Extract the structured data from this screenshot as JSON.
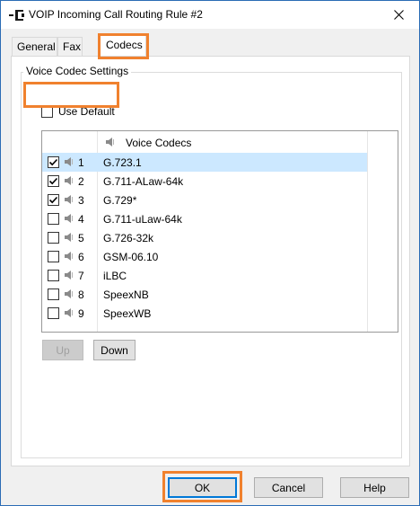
{
  "window": {
    "title": "VOIP Incoming Call Routing Rule #2"
  },
  "tabs": [
    {
      "label": "General"
    },
    {
      "label": "Fax"
    },
    {
      "label": "Codecs"
    }
  ],
  "group": {
    "label": "Voice Codec Settings"
  },
  "use_default": {
    "label": "Use Default",
    "checked": false
  },
  "codec_list": {
    "header": "Voice Codecs",
    "rows": [
      {
        "num": "1",
        "codec": "G.723.1",
        "checked": true,
        "selected": true
      },
      {
        "num": "2",
        "codec": "G.711-ALaw-64k",
        "checked": true,
        "selected": false
      },
      {
        "num": "3",
        "codec": "G.729*",
        "checked": true,
        "selected": false
      },
      {
        "num": "4",
        "codec": "G.711-uLaw-64k",
        "checked": false,
        "selected": false
      },
      {
        "num": "5",
        "codec": "G.726-32k",
        "checked": false,
        "selected": false
      },
      {
        "num": "6",
        "codec": "GSM-06.10",
        "checked": false,
        "selected": false
      },
      {
        "num": "7",
        "codec": "iLBC",
        "checked": false,
        "selected": false
      },
      {
        "num": "8",
        "codec": "SpeexNB",
        "checked": false,
        "selected": false
      },
      {
        "num": "9",
        "codec": "SpeexWB",
        "checked": false,
        "selected": false
      }
    ]
  },
  "buttons": {
    "up": "Up",
    "down": "Down",
    "ok": "OK",
    "cancel": "Cancel",
    "help": "Help"
  },
  "colors": {
    "highlight": "#f0812e",
    "selection": "#cce8ff",
    "accent": "#0078d7"
  }
}
